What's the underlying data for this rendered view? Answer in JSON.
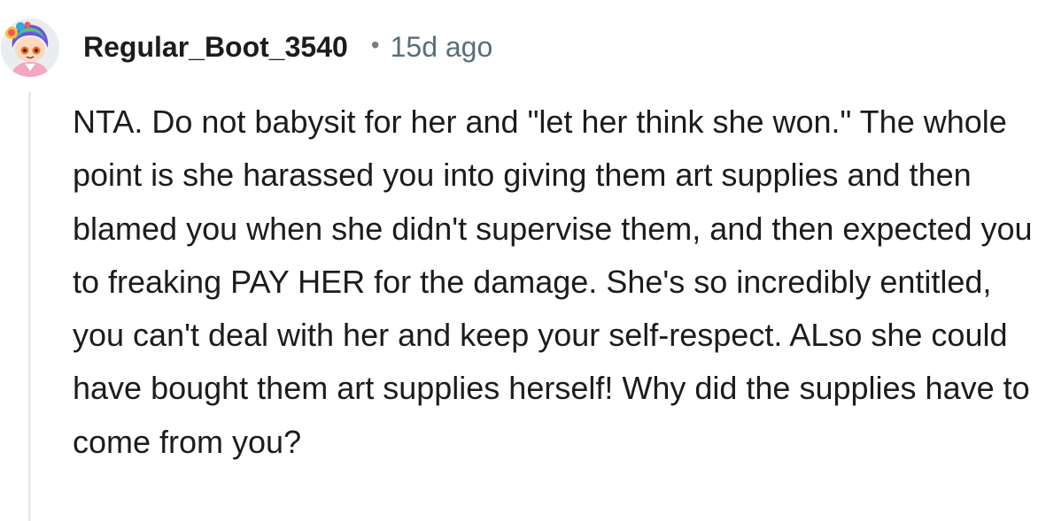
{
  "comment": {
    "author": "Regular_Boot_3540",
    "separator": "•",
    "timestamp": "15d ago",
    "avatar_icon": "snoo-avatar-rainbow-hair-icon",
    "body": "NTA. Do not babysit for her and \"let her think she won.\" The whole point is she harassed you into giving them art supplies and then blamed you when she didn't supervise them, and then expected you to freaking PAY HER for the damage. She's so incredibly entitled, you can't deal with her and keep your self-respect. ALso she could have bought them art supplies herself! Why did the supplies have to come from you?"
  },
  "colors": {
    "text": "#1c1c1c",
    "meta": "#576f76",
    "thread_line": "#e5ebee",
    "background": "#ffffff"
  }
}
